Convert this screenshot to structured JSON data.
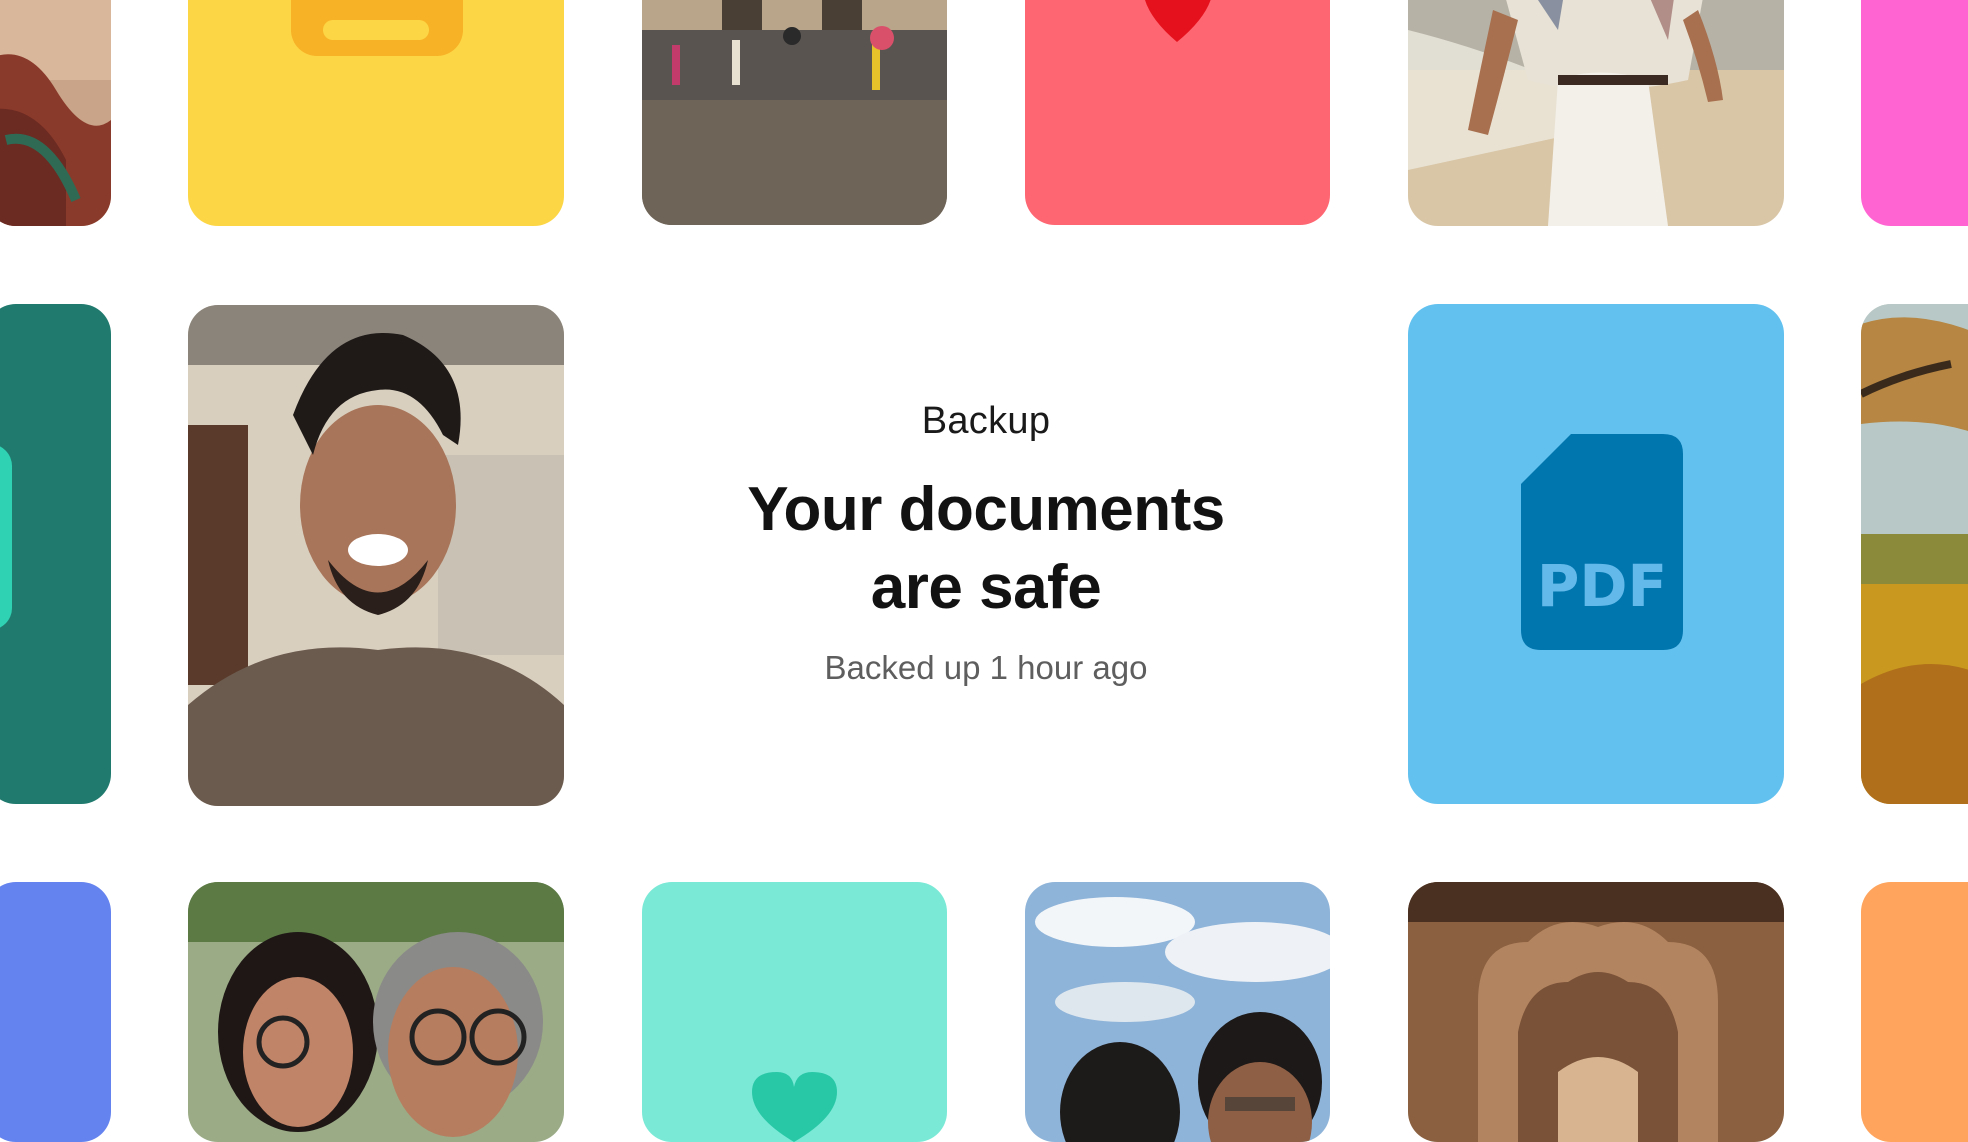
{
  "backup_card": {
    "eyebrow": "Backup",
    "headline_line1": "Your documents",
    "headline_line2": "are safe",
    "status": "Backed up 1 hour ago"
  },
  "tiles": {
    "pdf_label": "PDF"
  },
  "colors": {
    "yellow": "#fdd646",
    "yellow_dark": "#f8b226",
    "coral": "#fe6672",
    "heart_red": "#e5121d",
    "pink": "#ff64d2",
    "teal_dark": "#217a6e",
    "mint": "#7ae9d6",
    "blue_periwinkle": "#6583ef",
    "sky_blue": "#63c1ef",
    "pdf_blue": "#0076ae",
    "orange": "#fea45c"
  }
}
